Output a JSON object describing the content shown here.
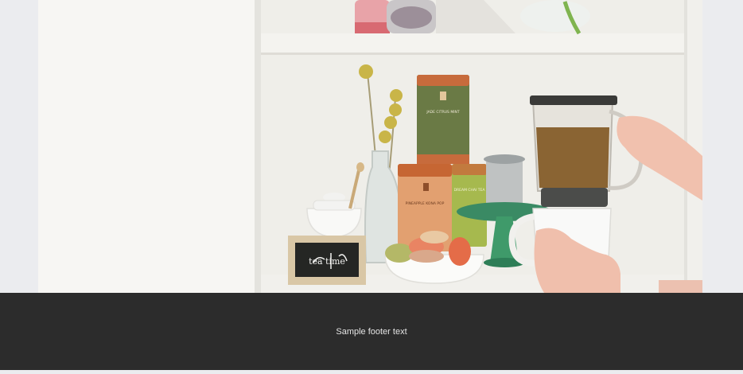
{
  "hero": {
    "alt": "Tea setup on a white shelf: tea tins, macarons, a chalkboard sign and a tea maker being held",
    "chalkboard_text": "tea time",
    "tins": {
      "top": "JADE CITRUS MINT",
      "left": "PINEAPPLE KONA POP",
      "right": "DREAM CHAI TEA"
    }
  },
  "footer": {
    "text": "Sample footer text"
  },
  "colors": {
    "footer_bg": "#2c2c2c",
    "page_bg": "#ebecef"
  }
}
